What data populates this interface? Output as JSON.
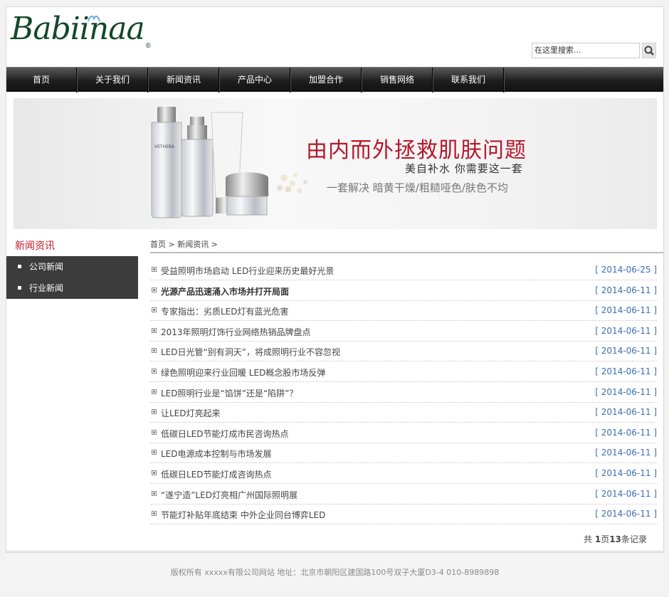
{
  "header": {
    "logo_text": "Babiinaa",
    "logo_mark": "®",
    "search_value": "在这里搜索..."
  },
  "nav": {
    "items": [
      "首页",
      "关于我们",
      "新闻资讯",
      "产品中心",
      "加盟合作",
      "销售网络",
      "联系我们"
    ]
  },
  "banner": {
    "title": "由内而外拯救肌肤问题",
    "subtitle": "美自补水 你需要这一套",
    "tagline": "一套解决 暗黄干燥/粗糙哑色/肤色不均",
    "product_label": "VETHERA"
  },
  "sidebar": {
    "title": "新闻资讯",
    "items": [
      "公司新闻",
      "行业新闻"
    ]
  },
  "breadcrumb": {
    "home": "首页",
    "sep1": " > ",
    "section": "新闻资讯",
    "sep2": " >"
  },
  "news": [
    {
      "title": "受益照明市场启动 LED行业迎来历史最好光景",
      "date": "[ 2014-06-25 ]",
      "bold": false
    },
    {
      "title": "光源产品迅速涌入市场并打开局面",
      "date": "[ 2014-06-11 ]",
      "bold": true
    },
    {
      "title": "专家指出：劣质LED灯有蓝光危害",
      "date": "[ 2014-06-11 ]",
      "bold": false
    },
    {
      "title": "2013年照明灯饰行业网络热销品牌盘点",
      "date": "[ 2014-06-11 ]",
      "bold": false
    },
    {
      "title": "LED日光管“别有洞天”，将成照明行业不容忽视",
      "date": "[ 2014-06-11 ]",
      "bold": false
    },
    {
      "title": "绿色照明迎来行业回暖 LED概念股市场反弹",
      "date": "[ 2014-06-11 ]",
      "bold": false
    },
    {
      "title": "LED照明行业是“馅饼”还是“陷阱”？",
      "date": "[ 2014-06-11 ]",
      "bold": false
    },
    {
      "title": "让LED灯亮起来",
      "date": "[ 2014-06-11 ]",
      "bold": false
    },
    {
      "title": "低碳日LED节能灯成市民咨询热点",
      "date": "[ 2014-06-11 ]",
      "bold": false
    },
    {
      "title": "LED电源成本控制与市场发展",
      "date": "[ 2014-06-11 ]",
      "bold": false
    },
    {
      "title": "低碳日LED节能灯成咨询热点",
      "date": "[ 2014-06-11 ]",
      "bold": false
    },
    {
      "title": "“遂宁造”LED灯亮相广州国际照明展",
      "date": "[ 2014-06-11 ]",
      "bold": false
    },
    {
      "title": "节能灯补贴年底结束 中外企业同台博弈LED",
      "date": "[ 2014-06-11 ]",
      "bold": false
    }
  ],
  "pager": {
    "prefix": "共 ",
    "pages": "1",
    "mid1": "页",
    "count": "13",
    "suffix": "条记录"
  },
  "footer": {
    "text": "版权所有 xxxxx有限公司网站 地址：北京市朝阳区建国路100号双子大厦D3-4 010-8989898"
  },
  "colors": {
    "logo": "#14472a",
    "banner_title": "#b5182b",
    "sidebar_title": "#c21b2c",
    "date": "#3a6fb3",
    "nav_bg": "#1e1e1e"
  },
  "icons": {
    "search": "magnifier-icon",
    "bullet": "square-bullet-icon"
  }
}
